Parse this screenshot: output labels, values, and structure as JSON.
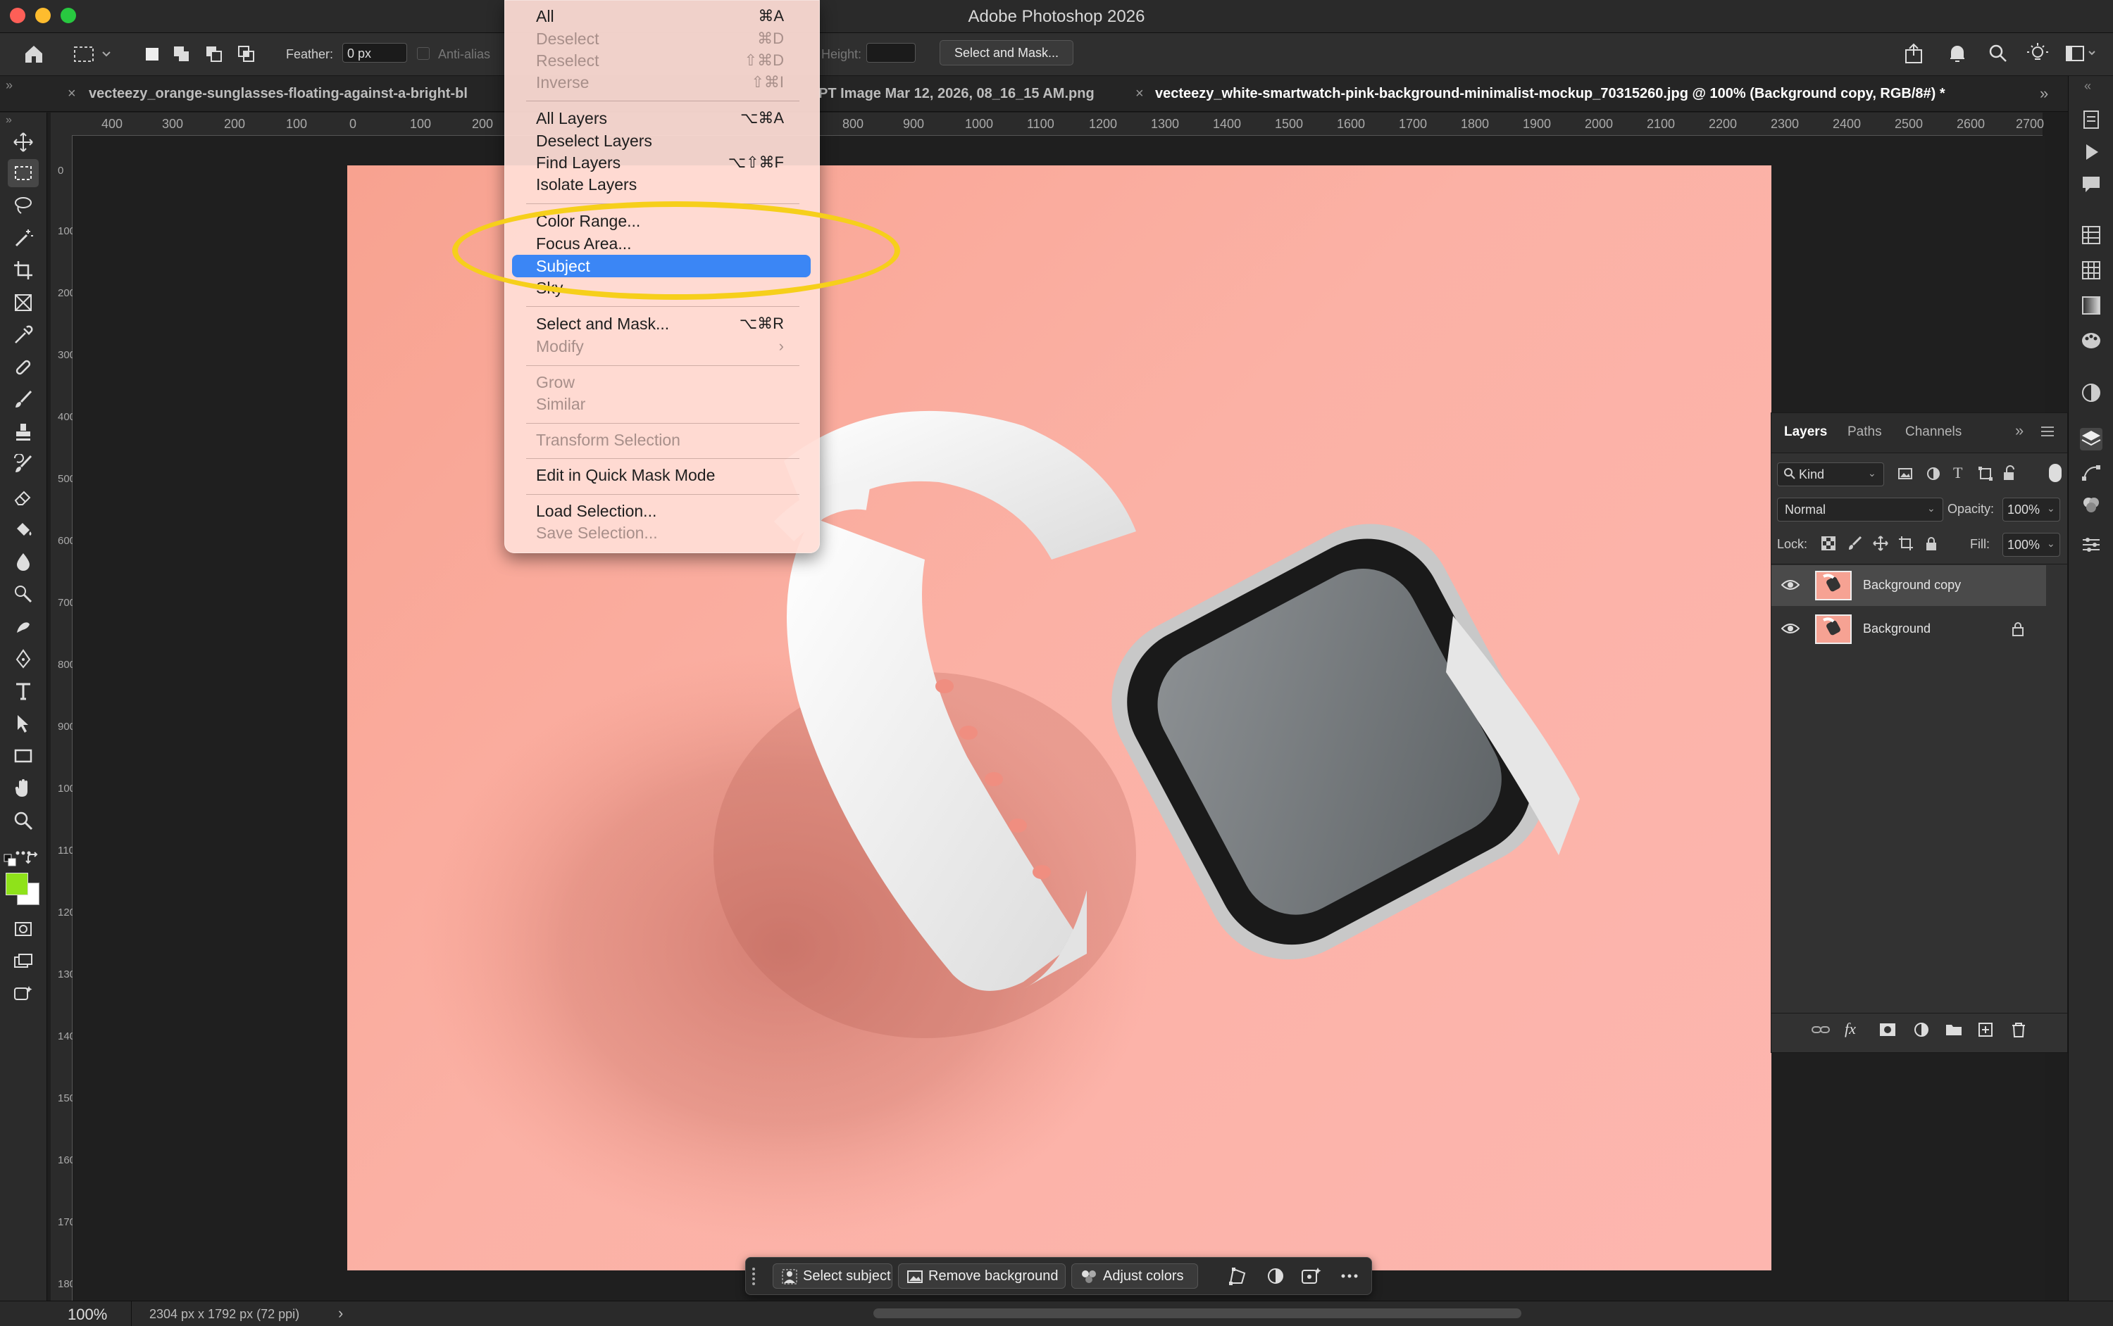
{
  "window": {
    "title": "Adobe Photoshop 2026"
  },
  "options_bar": {
    "feather_label": "Feather:",
    "feather_value": "0 px",
    "antialias_label": "Anti-alias",
    "height_label": "Height:",
    "select_and_mask_label": "Select and Mask..."
  },
  "tabs": [
    {
      "label": "vecteezy_orange-sunglasses-floating-against-a-bright-bl"
    },
    {
      "label": "PT Image Mar 12, 2026, 08_16_15 AM.png"
    },
    {
      "label": "vecteezy_white-smartwatch-pink-background-minimalist-mockup_70315260.jpg @ 100% (Background copy, RGB/8#) *"
    }
  ],
  "ruler": {
    "top_ticks": [
      "400",
      "300",
      "200",
      "100",
      "0",
      "100",
      "200",
      "800",
      "900",
      "1000",
      "1100",
      "1200",
      "1300",
      "1400",
      "1500",
      "1600",
      "1700",
      "1800",
      "1900",
      "2000",
      "2100",
      "2200",
      "2300",
      "2400",
      "2500",
      "2600",
      "2700"
    ],
    "left_ticks": [
      "0",
      "100",
      "200",
      "300",
      "400",
      "500",
      "600",
      "700",
      "800",
      "900",
      "1000",
      "1100",
      "1200",
      "1300",
      "1400",
      "1500",
      "1600",
      "1700",
      "1800"
    ]
  },
  "select_menu": {
    "items": [
      {
        "label": "All",
        "shortcut": "⌘A",
        "disabled": false
      },
      {
        "label": "Deselect",
        "shortcut": "⌘D",
        "disabled": true
      },
      {
        "label": "Reselect",
        "shortcut": "⇧⌘D",
        "disabled": true
      },
      {
        "label": "Inverse",
        "shortcut": "⇧⌘I",
        "disabled": true
      },
      {
        "label": "All Layers",
        "shortcut": "⌥⌘A",
        "disabled": false
      },
      {
        "label": "Deselect Layers",
        "shortcut": "",
        "disabled": false
      },
      {
        "label": "Find Layers",
        "shortcut": "⌥⇧⌘F",
        "disabled": false
      },
      {
        "label": "Isolate Layers",
        "shortcut": "",
        "disabled": false
      },
      {
        "label": "Color Range...",
        "shortcut": "",
        "disabled": false
      },
      {
        "label": "Focus Area...",
        "shortcut": "",
        "disabled": false
      },
      {
        "label": "Subject",
        "shortcut": "",
        "disabled": false,
        "highlighted": true
      },
      {
        "label": "Sky",
        "shortcut": "",
        "disabled": false
      },
      {
        "label": "Select and Mask...",
        "shortcut": "⌥⌘R",
        "disabled": false
      },
      {
        "label": "Modify",
        "shortcut": "›",
        "disabled": true
      },
      {
        "label": "Grow",
        "shortcut": "",
        "disabled": true
      },
      {
        "label": "Similar",
        "shortcut": "",
        "disabled": true
      },
      {
        "label": "Transform Selection",
        "shortcut": "",
        "disabled": true
      },
      {
        "label": "Edit in Quick Mask Mode",
        "shortcut": "",
        "disabled": false
      },
      {
        "label": "Load Selection...",
        "shortcut": "",
        "disabled": false
      },
      {
        "label": "Save Selection...",
        "shortcut": "",
        "disabled": true
      }
    ]
  },
  "layers_panel": {
    "tabs": [
      "Layers",
      "Paths",
      "Channels"
    ],
    "filter_kind": "Kind",
    "blend_mode": "Normal",
    "opacity_label": "Opacity:",
    "opacity_value": "100%",
    "lock_label": "Lock:",
    "fill_label": "Fill:",
    "fill_value": "100%",
    "layers": [
      {
        "name": "Background copy",
        "selected": true,
        "locked": false
      },
      {
        "name": "Background",
        "selected": false,
        "locked": true
      }
    ]
  },
  "contextual_taskbar": {
    "select_subject": "Select subject",
    "remove_background": "Remove background",
    "adjust_colors": "Adjust colors"
  },
  "status_bar": {
    "zoom": "100%",
    "doc_info": "2304 px x 1792 px (72 ppi)",
    "chevron": "›"
  },
  "colors": {
    "foreground": "#8fe21a",
    "background": "#ffffff",
    "highlight": "#3b86f5",
    "annotation": "#f6cf1b"
  }
}
